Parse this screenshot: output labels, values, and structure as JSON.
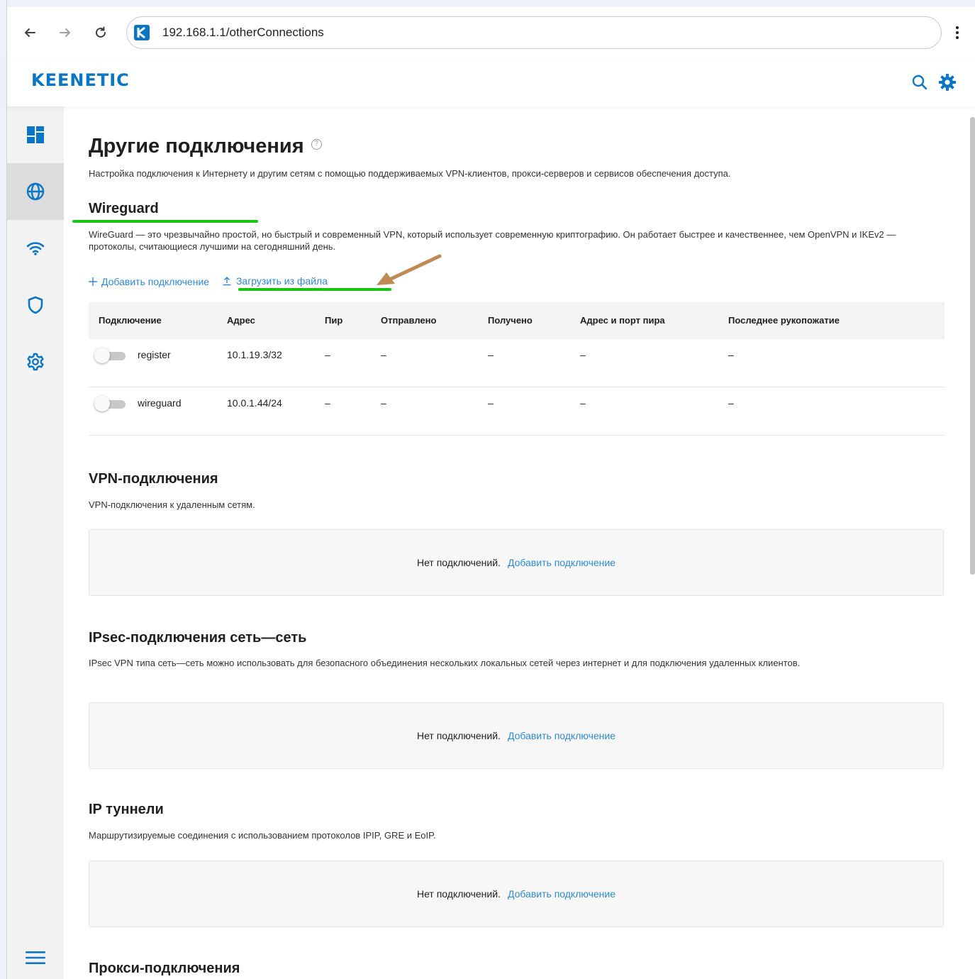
{
  "browser": {
    "back_icon": "arrow-left-icon",
    "forward_icon": "arrow-right-icon",
    "reload_icon": "reload-icon",
    "url": "192.168.1.1/otherConnections"
  },
  "header": {
    "logo": "KEENETIC",
    "search_icon": "search-icon",
    "settings_icon": "gear-icon"
  },
  "sidebar": {
    "items": [
      {
        "icon": "dashboard-icon",
        "active": false
      },
      {
        "icon": "globe-icon",
        "active": true
      },
      {
        "icon": "wifi-icon",
        "active": false
      },
      {
        "icon": "shield-icon",
        "active": false
      },
      {
        "icon": "gear-icon",
        "active": false
      }
    ],
    "menu_icon": "hamburger-icon"
  },
  "page": {
    "title": "Другие подключения",
    "description": "Настройка подключения к Интернету и другим сетям с помощью поддерживаемых VPN-клиентов, прокси-серверов и сервисов обеспечения доступа."
  },
  "wireguard": {
    "title": "Wireguard",
    "description": "WireGuard — это чрезвычайно простой, но быстрый и современный VPN, который использует современную криптографию. Он работает быстрее и качественнее, чем OpenVPN и IKEv2 — протоколы, считающиеся лучшими на сегодняшний день.",
    "add_label": "Добавить подключение",
    "upload_label": "Загрузить из файла",
    "columns": [
      "Подключение",
      "Адрес",
      "Пир",
      "Отправлено",
      "Получено",
      "Адрес и порт пира",
      "Последнее рукопожатие"
    ],
    "rows": [
      {
        "name": "register",
        "address": "10.1.19.3/32",
        "peer": "–",
        "sent": "–",
        "received": "–",
        "peer_address": "–",
        "handshake": "–",
        "enabled": false
      },
      {
        "name": "wireguard",
        "address": "10.0.1.44/24",
        "peer": "–",
        "sent": "–",
        "received": "–",
        "peer_address": "–",
        "handshake": "–",
        "enabled": false
      }
    ]
  },
  "vpn": {
    "title": "VPN-подключения",
    "description": "VPN-подключения к удаленным сетям.",
    "empty_text": "Нет подключений.",
    "add_link": "Добавить подключение"
  },
  "ipsec": {
    "title": "IPsec-подключения сеть—сеть",
    "description": "IPsec VPN типа сеть—сеть можно использовать для безопасного объединения нескольких локальных сетей через интернет и для подключения удаленных клиентов.",
    "empty_text": "Нет подключений.",
    "add_link": "Добавить подключение"
  },
  "tunnels": {
    "title": "IP туннели",
    "description": "Маршрутизируемые соединения с использованием протоколов IPIP, GRE и EoIP.",
    "empty_text": "Нет подключений.",
    "add_link": "Добавить подключение"
  },
  "proxy": {
    "title": "Прокси-подключения"
  },
  "colors": {
    "accent": "#2c8ad8",
    "brand": "#0a76c6",
    "annotation_line": "#19c213",
    "annotation_arrow": "#c08a55"
  }
}
